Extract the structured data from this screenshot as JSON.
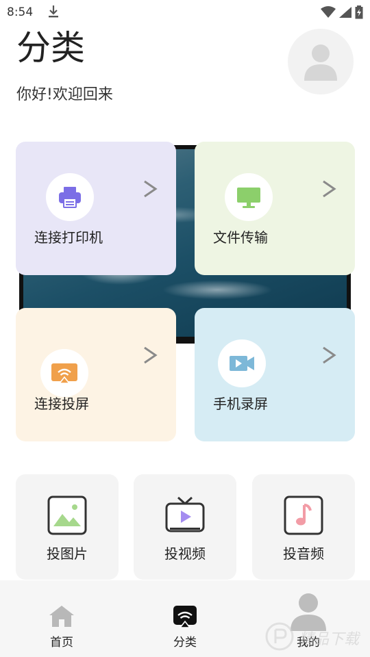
{
  "status": {
    "time": "8:54"
  },
  "header": {
    "title": "分类",
    "greeting": "你好!欢迎回来"
  },
  "cards": [
    {
      "label": "连接打印机",
      "icon": "printer-icon",
      "bg": "#e8e6f7",
      "accent": "#7b6ee6"
    },
    {
      "label": "文件传输",
      "icon": "monitor-icon",
      "bg": "#eef5e3",
      "accent": "#8ccf6b"
    },
    {
      "label": "连接投屏",
      "icon": "cast-icon",
      "bg": "#fdf3e4",
      "accent": "#f0a04b"
    },
    {
      "label": "手机录屏",
      "icon": "video-camera-icon",
      "bg": "#d6ecf4",
      "accent": "#7db8d8"
    }
  ],
  "tiles": [
    {
      "label": "投图片",
      "icon": "image-icon"
    },
    {
      "label": "投视频",
      "icon": "tv-play-icon"
    },
    {
      "label": "投音频",
      "icon": "music-note-icon"
    }
  ],
  "nav": [
    {
      "label": "首页",
      "icon": "home-icon",
      "active": false
    },
    {
      "label": "分类",
      "icon": "category-cast-icon",
      "active": true
    },
    {
      "label": "我的",
      "icon": "user-icon",
      "active": false
    }
  ],
  "watermark": {
    "text": "精品下载"
  }
}
